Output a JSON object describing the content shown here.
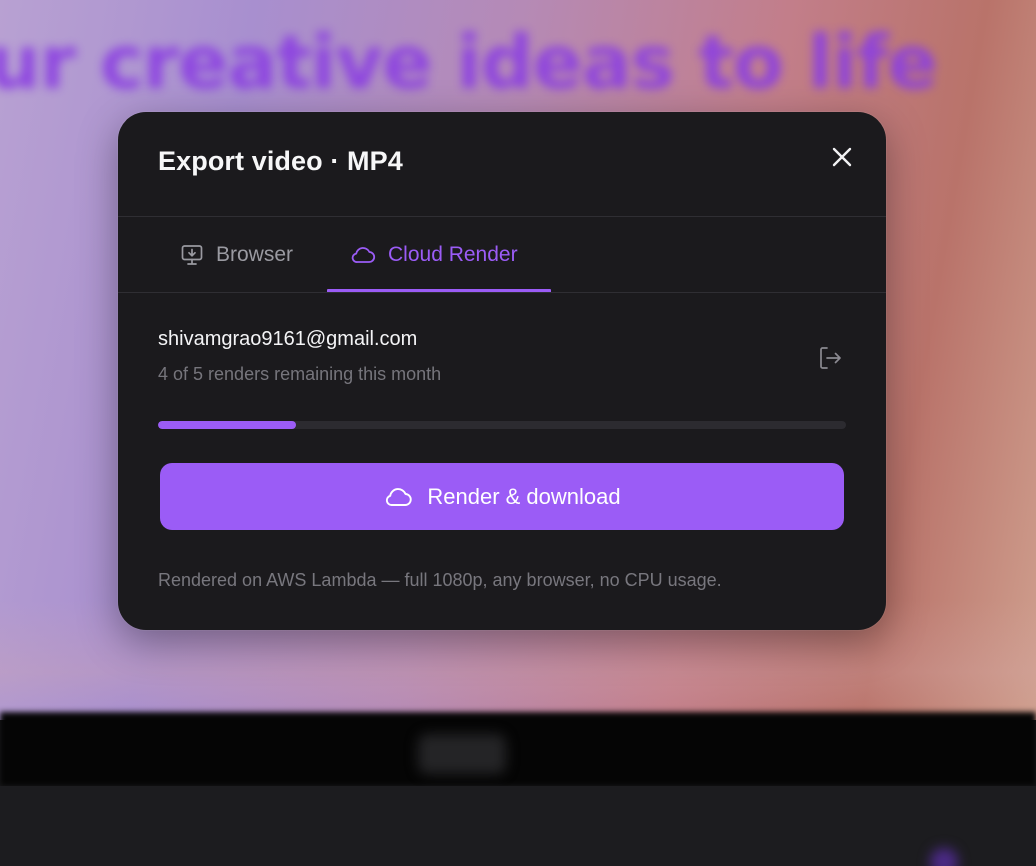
{
  "background": {
    "headline": "ur creative ideas to life"
  },
  "modal": {
    "title": "Export video · MP4",
    "close_icon": "close-icon",
    "tabs": [
      {
        "label": "Browser",
        "icon": "monitor-download-icon",
        "active": false
      },
      {
        "label": "Cloud Render",
        "icon": "cloud-icon",
        "active": true
      }
    ],
    "account": {
      "email": "shivamgrao9161@gmail.com",
      "remaining_text": "4 of 5 renders remaining this month",
      "renders_used": 1,
      "renders_total": 5,
      "logout_icon": "logout-icon"
    },
    "render_button": {
      "label": "Render & download",
      "icon": "cloud-icon"
    },
    "footnote": "Rendered on AWS Lambda — full 1080p, any browser, no CPU usage."
  },
  "colors": {
    "accent": "#9b5cf6",
    "modal_bg": "#1b1a1d",
    "muted_text": "#76757c"
  }
}
